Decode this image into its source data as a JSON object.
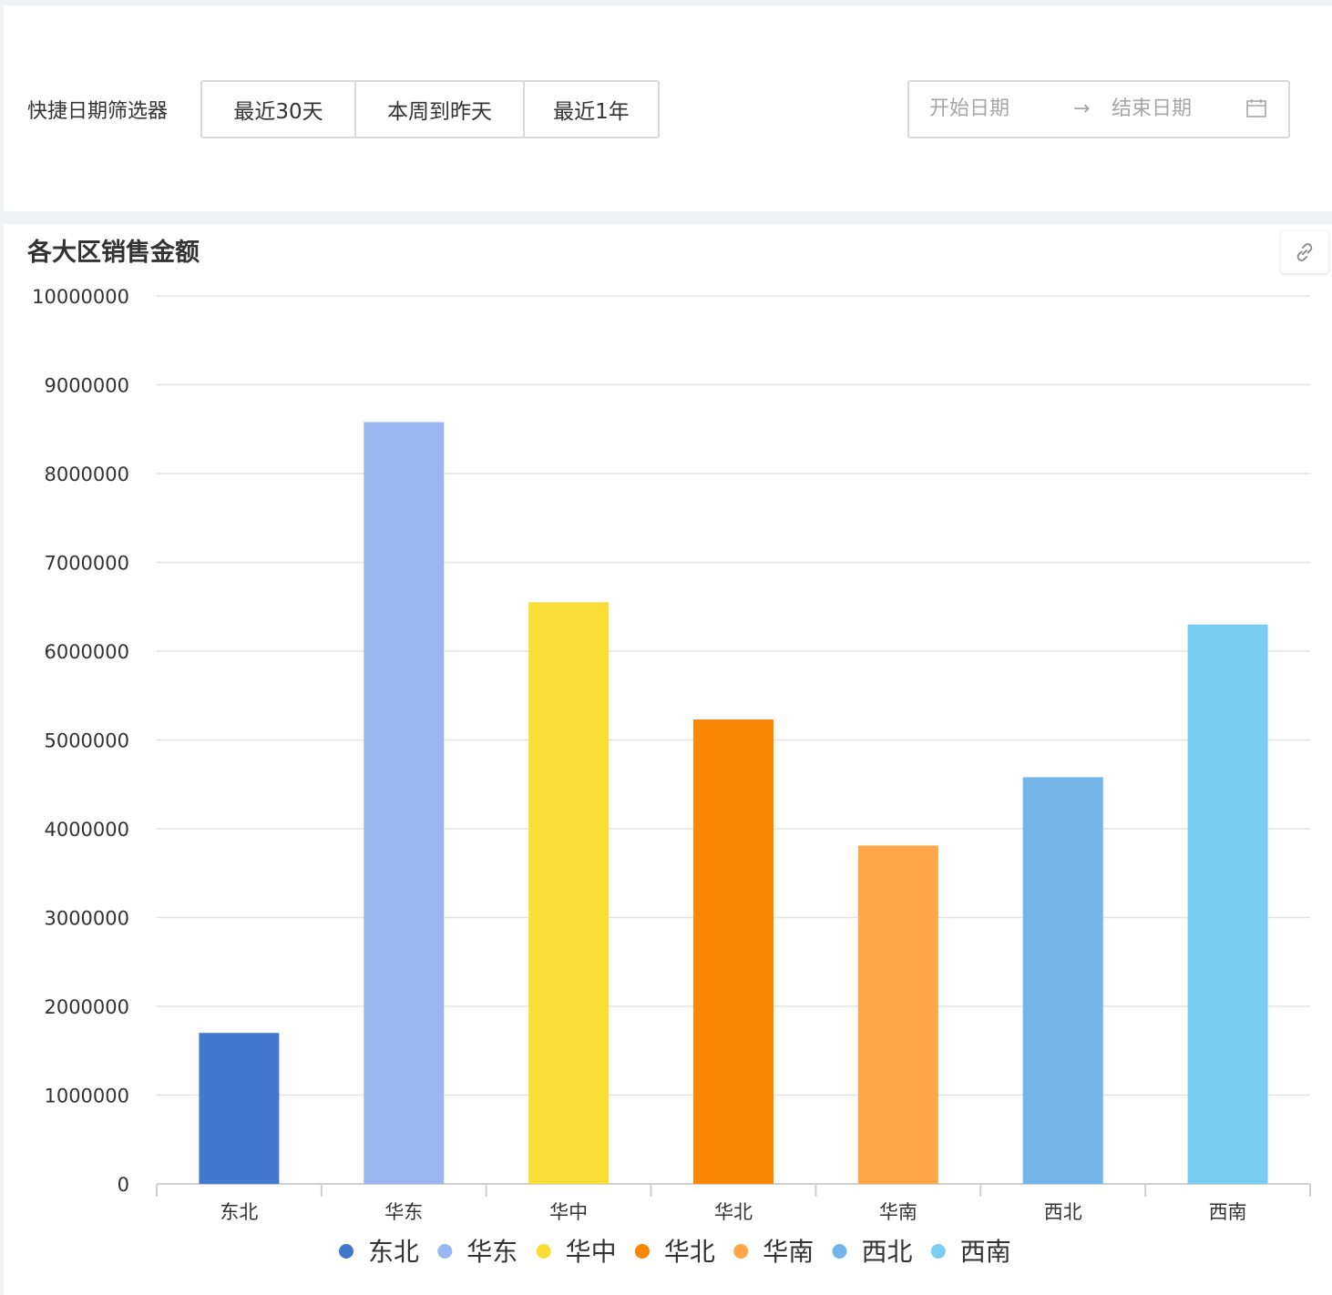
{
  "filter": {
    "label": "快捷日期筛选器",
    "buttons": [
      "最近30天",
      "本周到昨天",
      "最近1年"
    ],
    "start_placeholder": "开始日期",
    "arrow": "→",
    "end_placeholder": "结束日期",
    "calendar_icon": "calendar-icon"
  },
  "chart_card": {
    "link_icon": "link-icon"
  },
  "chart_data": {
    "type": "bar",
    "title": "各大区销售金额",
    "xlabel": "",
    "ylabel": "",
    "categories": [
      "东北",
      "华东",
      "华中",
      "华北",
      "华南",
      "西北",
      "西南"
    ],
    "values": [
      1700000,
      8580000,
      6550000,
      5230000,
      3810000,
      4580000,
      6300000
    ],
    "colors": [
      "#4478cf",
      "#9ab7f2",
      "#fbdd38",
      "#fb8603",
      "#fea649",
      "#73b5e9",
      "#79cdf1"
    ],
    "ylim": [
      0,
      10000000
    ],
    "yticks": [
      "0",
      "1000000",
      "2000000",
      "3000000",
      "4000000",
      "5000000",
      "6000000",
      "7000000",
      "8000000",
      "9000000",
      "10000000"
    ],
    "grid": true,
    "legend": "bottom-center"
  }
}
